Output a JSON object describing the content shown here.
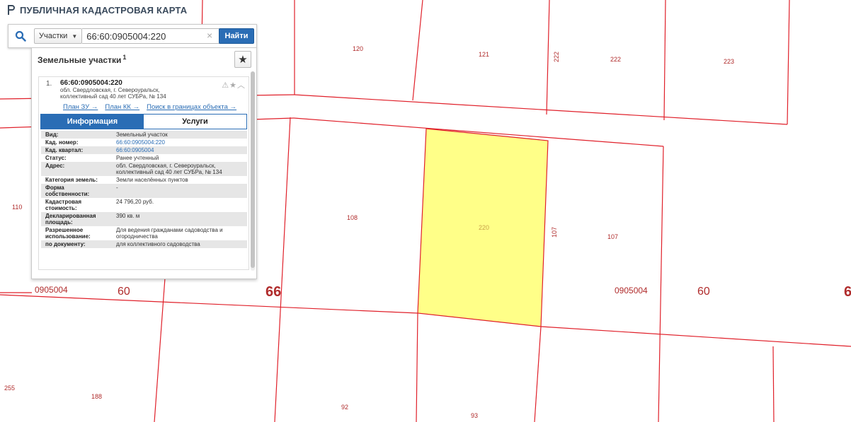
{
  "app": {
    "title": "ПУБЛИЧНАЯ КАДАСТРОВАЯ КАРТА"
  },
  "search": {
    "type_label": "Участки",
    "query": "66:60:0905004:220",
    "find_label": "Найти"
  },
  "panel": {
    "title": "Земельные участки",
    "count": "1"
  },
  "result": {
    "index": "1.",
    "cad_number": "66:60:0905004:220",
    "address_line1": "обл. Свердловская, г. Североуральск,",
    "address_line2": "коллективный сад 40 лет СУБРа, № 134",
    "links": {
      "plan_zu": "План ЗУ →",
      "plan_kk": "План КК →",
      "search_in_bounds": "Поиск в границах объекта →"
    },
    "tabs": {
      "info": "Информация",
      "services": "Услуги"
    }
  },
  "info_rows": [
    {
      "key": "Вид:",
      "value": "Земельный участок",
      "link": false
    },
    {
      "key": "Кад. номер:",
      "value": "66:60:0905004:220",
      "link": true
    },
    {
      "key": "Кад. квартал:",
      "value": "66:60:0905004",
      "link": true
    },
    {
      "key": "Статус:",
      "value": "Ранее учтенный",
      "link": false
    },
    {
      "key": "Адрес:",
      "value": "обл. Свердловская, г. Североуральск, коллективный сад 40 лет СУБРа, № 134",
      "link": false
    },
    {
      "key": "Категория земель:",
      "value": "Земли населённых пунктов",
      "link": false
    },
    {
      "key": "Форма собственности:",
      "value": "-",
      "link": false
    },
    {
      "key": "Кадастровая стоимость:",
      "value": "24 796,20 руб.",
      "link": false
    },
    {
      "key": "Декларированная площадь:",
      "value": "390 кв. м",
      "link": false
    },
    {
      "key": "Разрешенное использование:",
      "value": "Для ведения гражданами садоводства и огородничества",
      "link": false
    },
    {
      "key": "по документу:",
      "value": "для коллективного садоводства",
      "link": false
    }
  ],
  "map": {
    "colors": {
      "boundary": "#e0202a",
      "selected_fill": "#ffff88",
      "label": "#b02c2c"
    },
    "labels": {
      "p120": "120",
      "p121": "121",
      "p222v": "222",
      "p222": "222",
      "p223": "223",
      "p110": "110",
      "p108": "108",
      "p220": "220",
      "p107v": "107",
      "p107": "107",
      "q_left": "0905004",
      "n60_left": "60",
      "n66": "66",
      "q_right": "0905004",
      "n60_right": "60",
      "n6_cut": "6",
      "p255": "255",
      "p188": "188",
      "p92": "92",
      "p93": "93"
    }
  }
}
